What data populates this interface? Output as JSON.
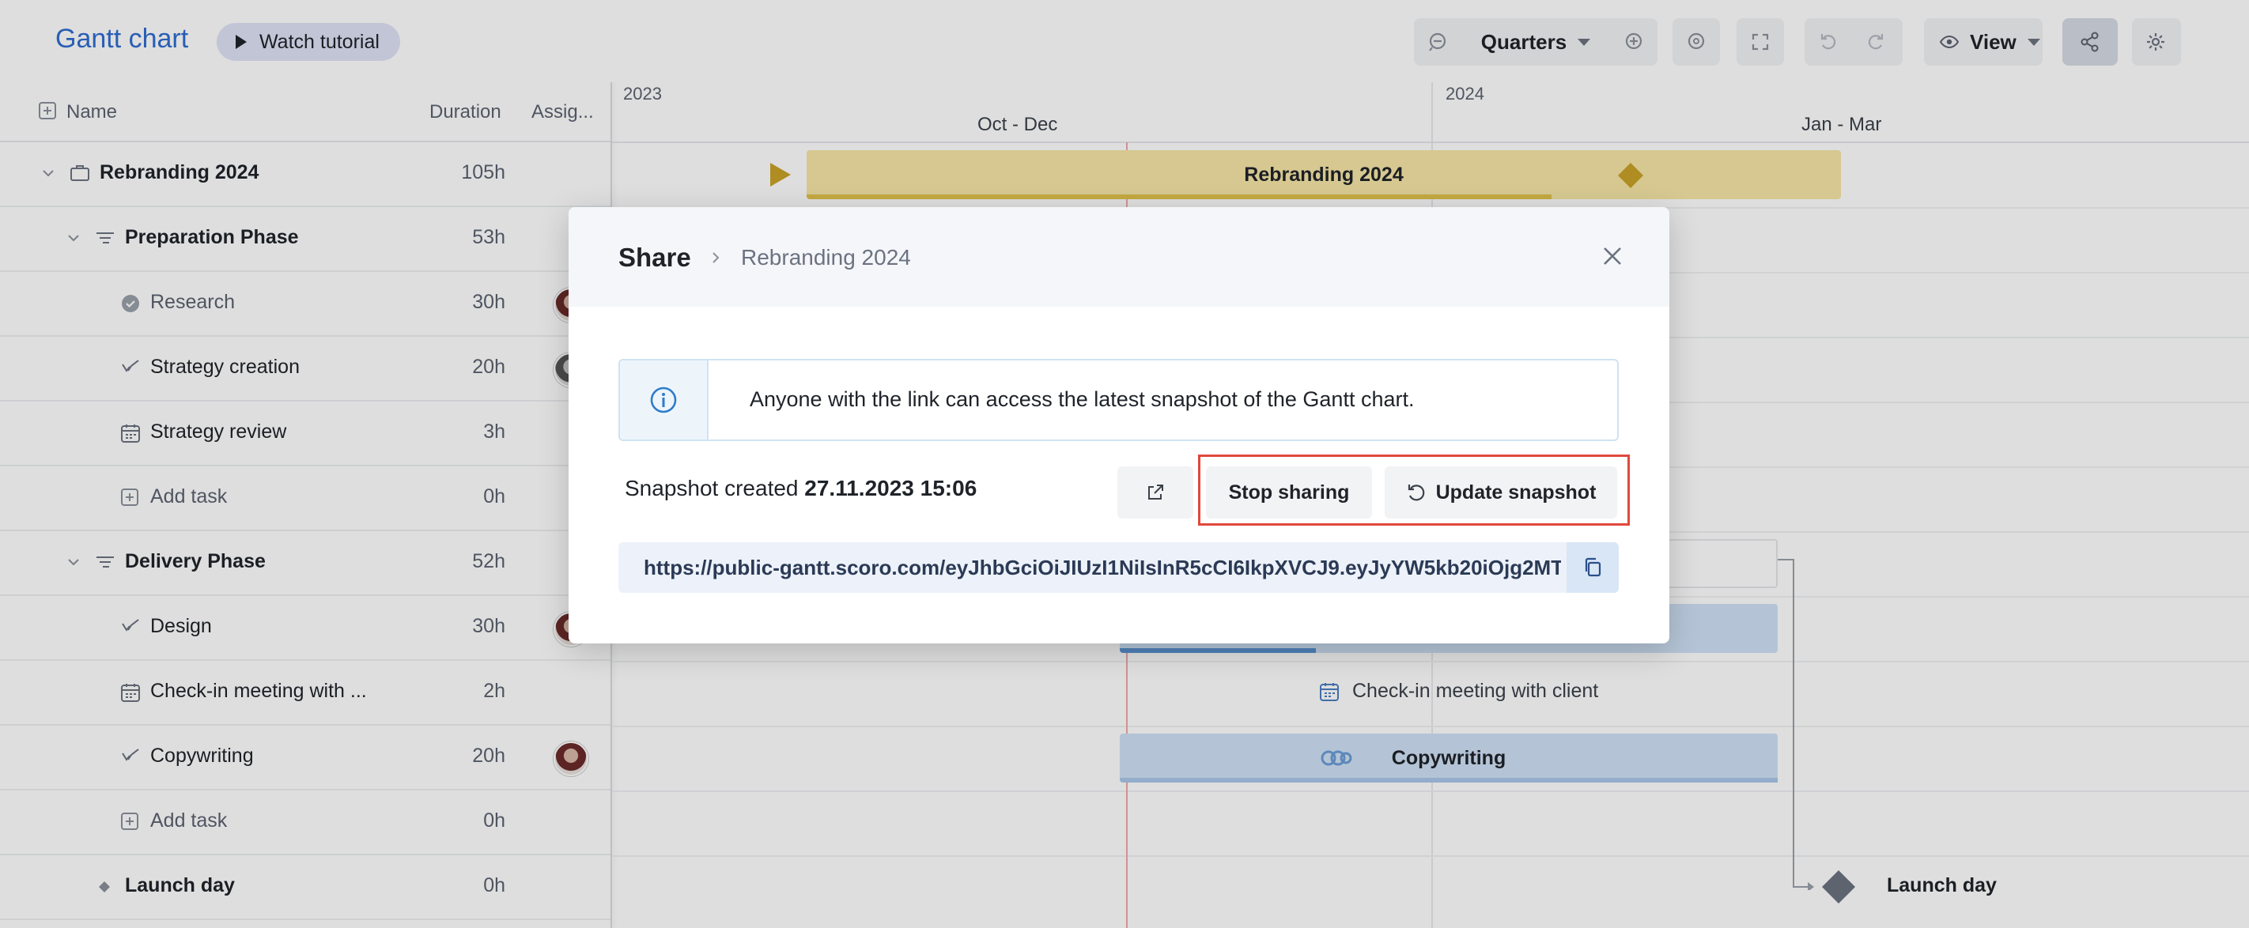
{
  "app": {
    "title": "Gantt chart",
    "tutorial_label": "Watch tutorial"
  },
  "toolbar": {
    "zoom_label": "Quarters",
    "view_label": "View"
  },
  "grid": {
    "columns": {
      "name": "Name",
      "duration": "Duration",
      "assignee": "Assig..."
    },
    "rows": [
      {
        "name": "Rebranding 2024",
        "duration": "105h"
      },
      {
        "name": "Preparation Phase",
        "duration": "53h"
      },
      {
        "name": "Research",
        "duration": "30h"
      },
      {
        "name": "Strategy creation",
        "duration": "20h"
      },
      {
        "name": "Strategy review",
        "duration": "3h"
      },
      {
        "name": "Add task",
        "duration": "0h"
      },
      {
        "name": "Delivery Phase",
        "duration": "52h"
      },
      {
        "name": "Design",
        "duration": "30h"
      },
      {
        "name": "Check-in meeting with ...",
        "duration": "2h"
      },
      {
        "name": "Copywriting",
        "duration": "20h"
      },
      {
        "name": "Add task",
        "duration": "0h"
      },
      {
        "name": "Launch day",
        "duration": "0h"
      }
    ]
  },
  "timeline": {
    "years": [
      "2023",
      "2024"
    ],
    "quarters": [
      "Oct - Dec",
      "Jan - Mar"
    ],
    "bars": {
      "rebranding": "Rebranding 2024",
      "checkin": "Check-in meeting with client",
      "copywriting": "Copywriting",
      "launch": "Launch day"
    }
  },
  "modal": {
    "title": "Share",
    "breadcrumb": "Rebranding 2024",
    "info": "Anyone with the link can access the latest snapshot of the Gantt chart.",
    "snapshot_prefix": "Snapshot created",
    "snapshot_date": "27.11.2023 15:06",
    "stop_label": "Stop sharing",
    "update_label": "Update snapshot",
    "link": "https://public-gantt.scoro.com/eyJhbGciOiJIUzI1NiIsInR5cCI6IkpXVCJ9.eyJyYW5kb20iOjg2MT..."
  },
  "colors": {
    "accent": "#2f6cd0",
    "highlight": "#e0483c",
    "summary_bar": "#f6e6a6",
    "task_bar": "#cfe2f6"
  }
}
